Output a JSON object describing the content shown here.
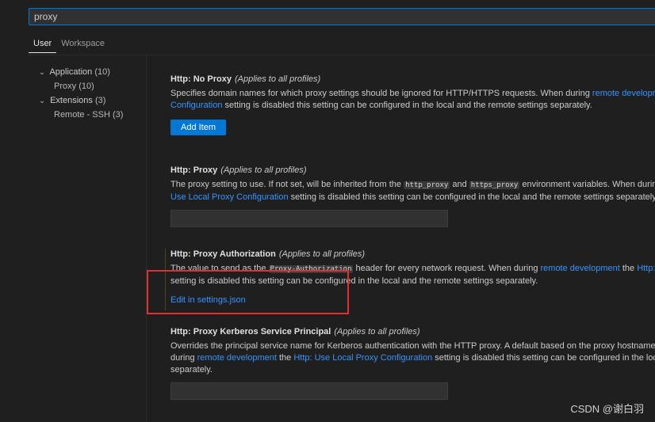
{
  "search": {
    "value": "proxy"
  },
  "tabs": [
    {
      "label": "User"
    },
    {
      "label": "Workspace"
    }
  ],
  "tree": {
    "application": {
      "label": "Application",
      "count": "(10)"
    },
    "proxy": {
      "label": "Proxy",
      "count": "(10)"
    },
    "extensions": {
      "label": "Extensions",
      "count": "(3)"
    },
    "remote_ssh": {
      "label": "Remote - SSH",
      "count": "(3)"
    }
  },
  "settings": {
    "no_proxy": {
      "title": "Http: No Proxy",
      "scope": "(Applies to all profiles)",
      "desc1_pre": "Specifies domain names for which proxy settings should be ignored for HTTP/HTTPS requests. When during ",
      "desc1_link": "remote development",
      "desc2_link": "Configuration",
      "desc2_post": " setting is disabled this setting can be configured in the local and the remote settings separately.",
      "button": "Add Item"
    },
    "proxy": {
      "title": "Http: Proxy",
      "scope": "(Applies to all profiles)",
      "desc1_pre": "The proxy setting to use. If not set, will be inherited from the ",
      "code1": "http_proxy",
      "desc1_mid": " and ",
      "code2": "https_proxy",
      "desc1_post": " environment variables. When during ",
      "desc2_link": "Use Local Proxy Configuration",
      "desc2_post": " setting is disabled this setting can be configured in the local and the remote settings separately."
    },
    "proxy_authorization": {
      "title": "Http: Proxy Authorization",
      "scope": "(Applies to all profiles)",
      "desc1_pre": "The value to send as the ",
      "code1": "Proxy-Authorization",
      "desc1_mid": " header for every network request. When during ",
      "desc1_link": "remote development",
      "desc1_the": " the ",
      "desc1_link2": "Http: Us",
      "desc2": "setting is disabled this setting can be configured in the local and the remote settings separately.",
      "edit_link": "Edit in settings.json"
    },
    "kerberos": {
      "title": "Http: Proxy Kerberos Service Principal",
      "scope": "(Applies to all profiles)",
      "desc1": "Overrides the principal service name for Kerberos authentication with the HTTP proxy. A default based on the proxy hostname is",
      "desc2_pre": "during ",
      "desc2_link": "remote development",
      "desc2_the": " the ",
      "desc2_link2": "Http: Use Local Proxy Configuration",
      "desc2_post": " setting is disabled this setting can be configured in the local",
      "desc3": "separately."
    }
  },
  "watermark": "CSDN @谢白羽",
  "colors": {
    "accent": "#0078d4",
    "link": "#3794ff",
    "annotation": "#e03030"
  }
}
